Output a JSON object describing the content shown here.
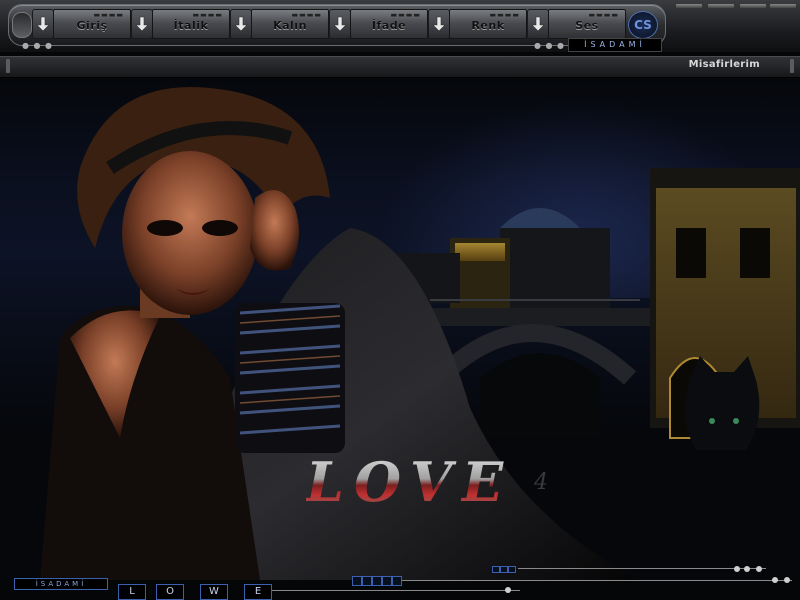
{
  "toolbar": {
    "buttons": [
      {
        "label": "Giriş"
      },
      {
        "label": "İtalik"
      },
      {
        "label": "Kalın"
      },
      {
        "label": "İfade"
      },
      {
        "label": "Renk"
      },
      {
        "label": "Ses"
      }
    ],
    "badge": "CS",
    "brand": "İSADAMİ"
  },
  "subbar": {
    "visitors": "Misafirlerim"
  },
  "scene": {
    "title_word": "LOVE",
    "title_suffix": "4"
  },
  "footer": {
    "brand": "İSADAMİ",
    "letters": [
      "L",
      "O",
      "W",
      "E"
    ]
  },
  "colors": {
    "accent": "#3c5fb0",
    "toolbar": "#2a2c30"
  }
}
